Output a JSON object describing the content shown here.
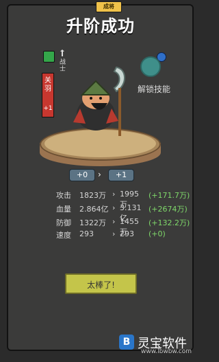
{
  "header": {
    "tag": "成将",
    "title": "升阶成功"
  },
  "hero": {
    "badge_icon": "shield-icon",
    "class_label": "战士",
    "name": "关羽",
    "plus_label": "+1"
  },
  "skill": {
    "label": "解锁技能"
  },
  "levels": {
    "from": "+0",
    "to": "+1"
  },
  "stats": [
    {
      "label": "攻击",
      "old": "1823万",
      "new": "1995万",
      "diff": "(+171.7万)"
    },
    {
      "label": "血量",
      "old": "2.864亿",
      "new": "3.131亿",
      "diff": "(+2674万)"
    },
    {
      "label": "防御",
      "old": "1322万",
      "new": "1455万",
      "diff": "(+132.2万)"
    },
    {
      "label": "速度",
      "old": "293",
      "new": "293",
      "diff": "(+0)"
    }
  ],
  "button": {
    "label": "太棒了!"
  },
  "watermark": {
    "icon": "B",
    "text": "灵宝软件",
    "url": "www.lbwbw.com"
  }
}
